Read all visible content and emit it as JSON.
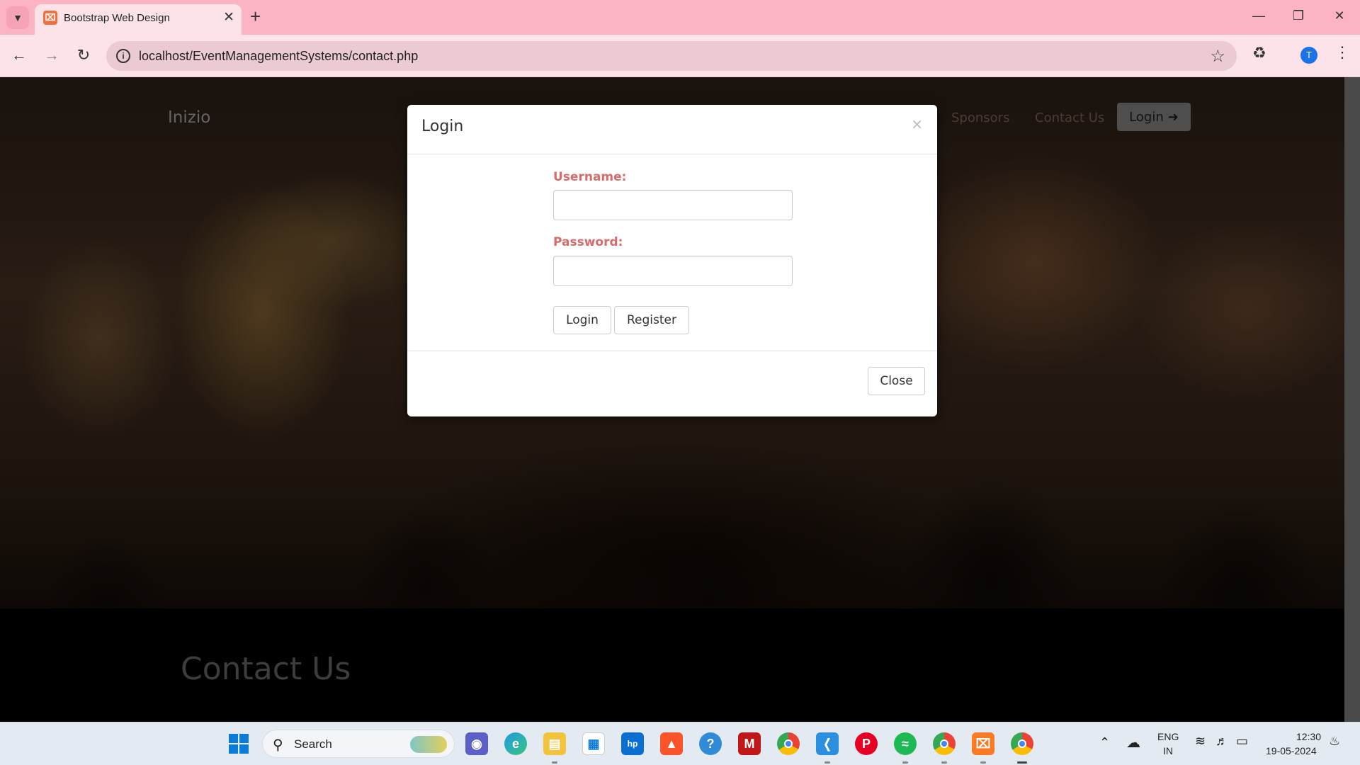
{
  "browser": {
    "tab_title": "Bootstrap Web Design",
    "url": "localhost/EventManagementSystems/contact.php",
    "profile_initial": "T"
  },
  "site": {
    "brand": "Inizio",
    "nav": [
      "Sponsors",
      "Contact Us"
    ],
    "login_button": "Login",
    "section_title": "Contact Us"
  },
  "modal": {
    "title": "Login",
    "close_x": "×",
    "username_label": "Username:",
    "password_label": "Password:",
    "username_value": "",
    "password_value": "",
    "login_button": "Login",
    "register_button": "Register",
    "close_button": "Close"
  },
  "taskbar": {
    "search_label": "Search",
    "lang_top": "ENG",
    "lang_bottom": "IN",
    "time": "12:30",
    "date": "19-05-2024",
    "apps": [
      "start",
      "search",
      "teams",
      "edge",
      "file-explorer",
      "store",
      "myhp",
      "brave",
      "help",
      "mcafee",
      "chrome",
      "vscode",
      "pinterest",
      "spotify",
      "chrome-profile",
      "xampp",
      "chrome-active"
    ]
  },
  "colors": {
    "titlebar": "#fcb4c4",
    "toolbar": "#fbe3e9",
    "label_red": "#d86a6a"
  }
}
